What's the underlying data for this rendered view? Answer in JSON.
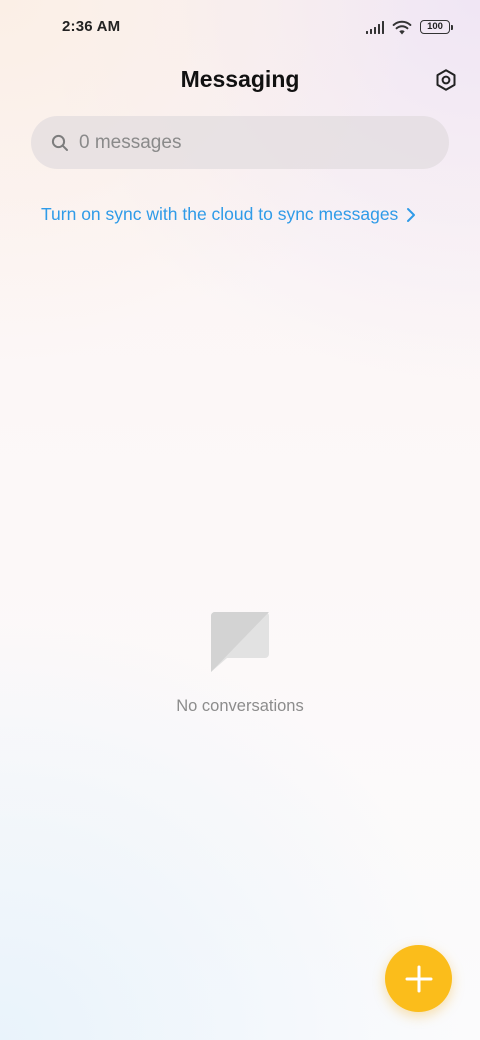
{
  "status_bar": {
    "time": "2:36 AM",
    "battery_level": "100",
    "icons": [
      "signal-icon",
      "wifi-icon",
      "battery-icon"
    ]
  },
  "header": {
    "title": "Messaging",
    "settings_icon": "gear-icon"
  },
  "search": {
    "placeholder": "0 messages",
    "value": "",
    "icon": "search-icon"
  },
  "sync": {
    "label": "Turn on sync with the cloud to sync messages",
    "icon": "chevron-right-icon"
  },
  "empty_state": {
    "icon": "conversation-placeholder-icon",
    "text": "No conversations"
  },
  "fab": {
    "icon": "plus-icon"
  },
  "colors": {
    "accent_link": "#2f9be8",
    "fab": "#fbbd1b",
    "title": "#111111",
    "muted_text": "#8c8c8c"
  }
}
